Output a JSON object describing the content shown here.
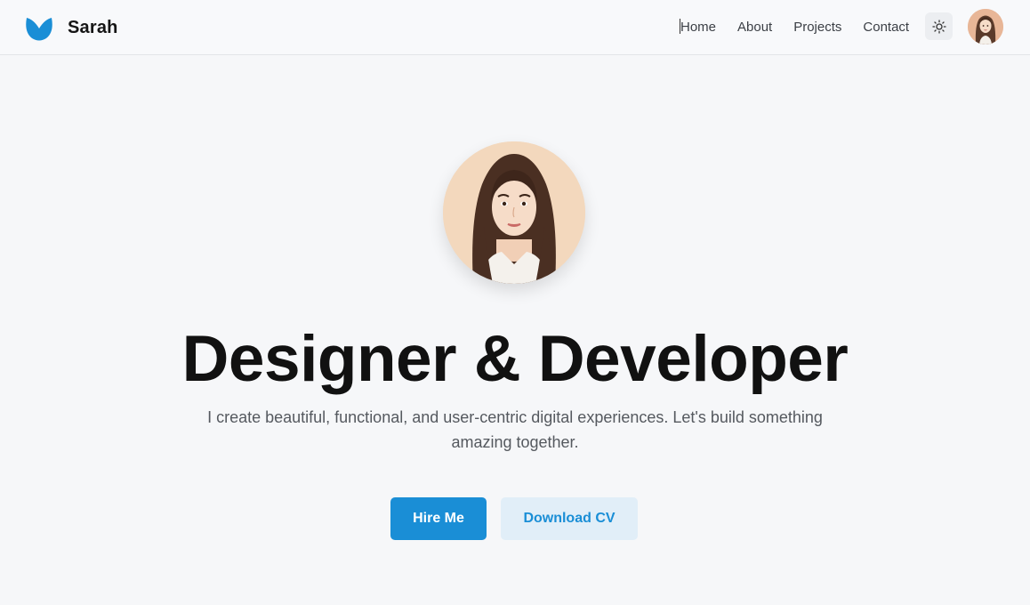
{
  "brand": {
    "name": "Sarah",
    "logo_icon": "brand-logo-icon",
    "accent": "#1a8ed6"
  },
  "nav": {
    "items": [
      {
        "label": "Home"
      },
      {
        "label": "About"
      },
      {
        "label": "Projects"
      },
      {
        "label": "Contact"
      }
    ],
    "theme_toggle_icon": "sun-icon"
  },
  "hero": {
    "title": "Designer & Developer",
    "subtitle": "I create beautiful, functional, and user-centric digital experiences. Let's build something amazing together.",
    "primary_button": "Hire Me",
    "secondary_button": "Download CV"
  },
  "colors": {
    "background": "#f6f7f9",
    "primary": "#1a8ed6",
    "secondary_bg": "#e1eef8",
    "text": "#111111",
    "muted": "#55595f"
  }
}
